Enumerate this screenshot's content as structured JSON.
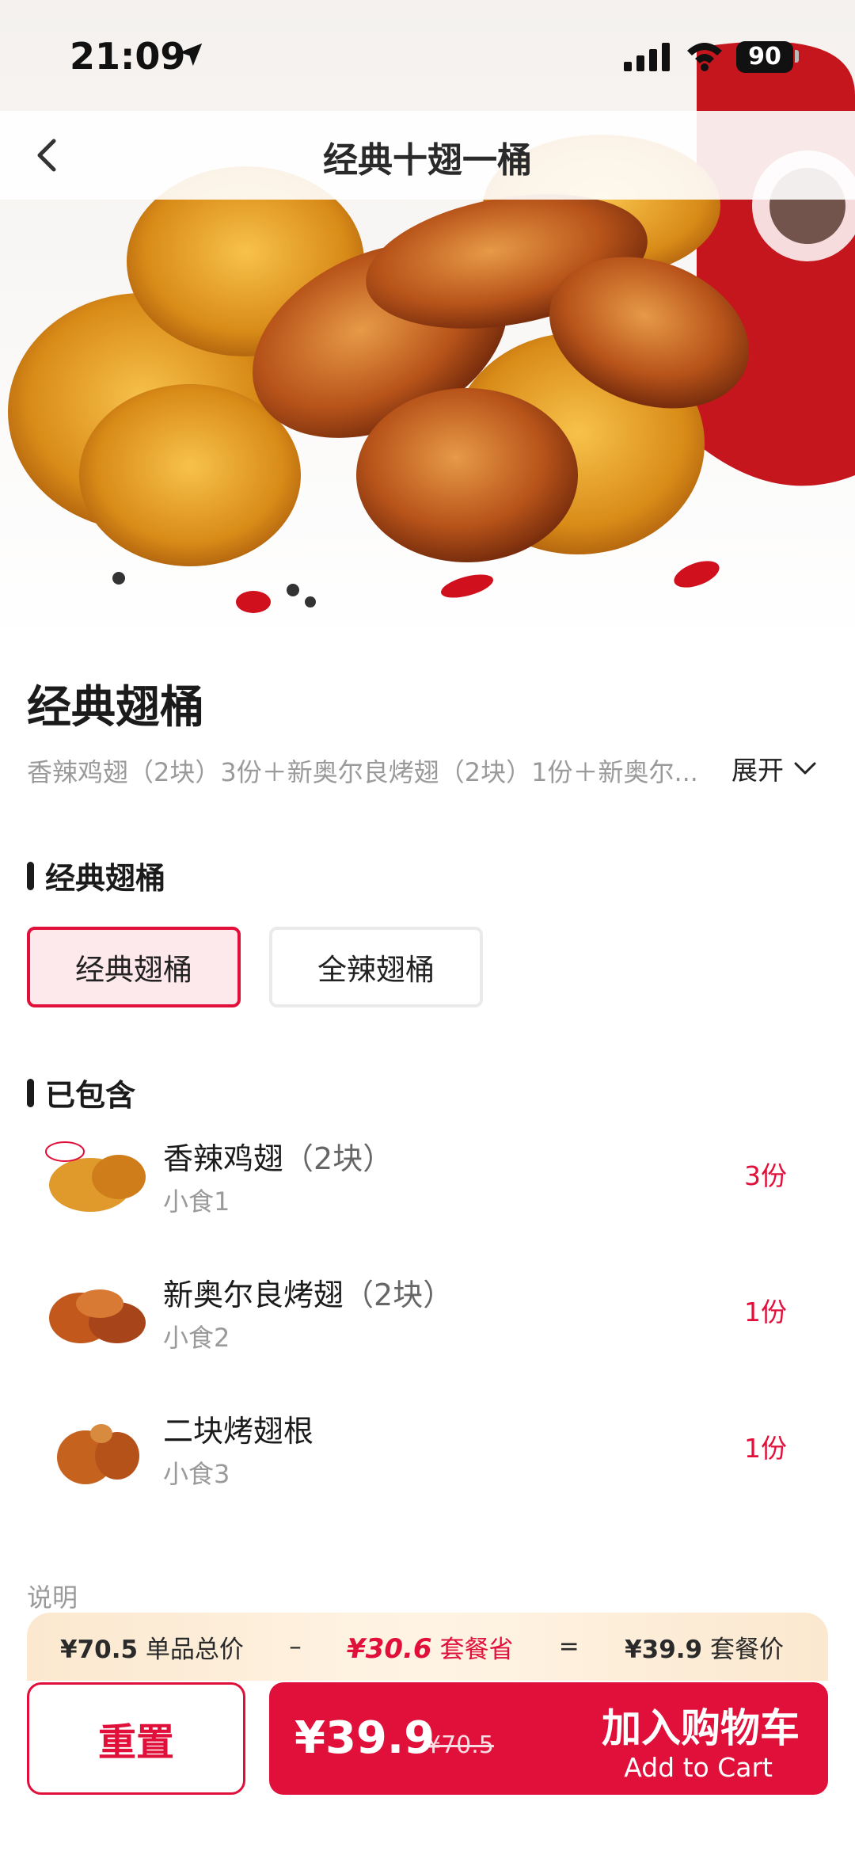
{
  "status_bar": {
    "time": "21:09",
    "battery": "90"
  },
  "nav": {
    "title": "经典十翅一桶"
  },
  "product": {
    "title": "经典翅桶",
    "description": "香辣鸡翅（2块）3份＋新奥尔良烤翅（2块）1份＋新奥尔...",
    "expand_label": "展开"
  },
  "flavor_section": {
    "heading": "经典翅桶",
    "options": [
      {
        "label": "经典翅桶",
        "selected": true
      },
      {
        "label": "全辣翅桶",
        "selected": false
      }
    ]
  },
  "included_section": {
    "heading": "已包含",
    "items": [
      {
        "name": "香辣鸡翅",
        "note": "（2块）",
        "category": "小食1",
        "count": "3份"
      },
      {
        "name": "新奥尔良烤翅",
        "note": "（2块）",
        "category": "小食2",
        "count": "1份"
      },
      {
        "name": "二块烤翅根",
        "note": "",
        "category": "小食3",
        "count": "1份"
      }
    ]
  },
  "note_label": "说明",
  "summary": {
    "single_total": "¥70.5",
    "single_total_label": "单品总价",
    "minus": "–",
    "savings": "¥30.6",
    "savings_label": "套餐省",
    "equals": "=",
    "combo_price": "¥39.9",
    "combo_price_label": "套餐价"
  },
  "actions": {
    "reset_label": "重置",
    "cart_price": "¥39.9",
    "cart_original_price": "¥70.5",
    "cart_label": "加入购物车",
    "cart_sub_label": "Add to Cart"
  },
  "colors": {
    "accent": "#e0103a",
    "selected_bg": "#fde8ec"
  },
  "icons": [
    "location-arrow-icon",
    "signal-icon",
    "wifi-icon",
    "battery-icon",
    "back-icon",
    "chevron-down-icon"
  ]
}
